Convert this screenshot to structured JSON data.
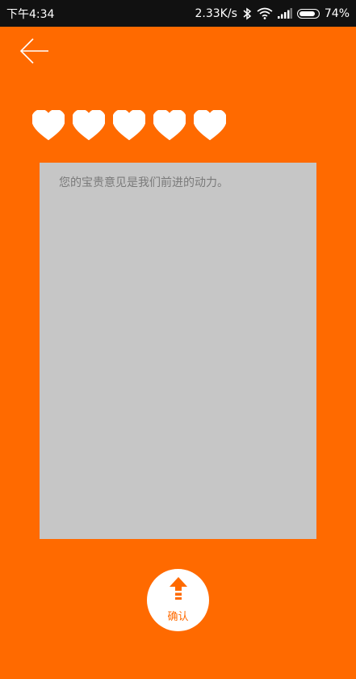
{
  "status_bar": {
    "time": "下午4:34",
    "network_speed": "2.33K/s",
    "battery": "74%",
    "icons": [
      "bluetooth-icon",
      "wifi-icon",
      "signal-icon",
      "battery-icon"
    ]
  },
  "header": {
    "back_icon": "arrow-left-icon"
  },
  "rating": {
    "max": 5,
    "value": 5,
    "icon": "heart-icon",
    "color": "#ffffff"
  },
  "feedback": {
    "placeholder": "您的宝贵意见是我们前进的动力。",
    "value": ""
  },
  "confirm": {
    "label": "确认",
    "icon": "upload-arrow-icon"
  },
  "colors": {
    "accent": "#ff6a00",
    "panel": "#c6c6c6",
    "status_bar": "#111111"
  }
}
